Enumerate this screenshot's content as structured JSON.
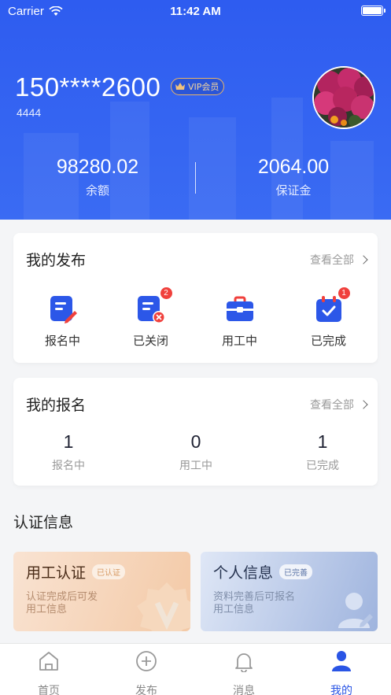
{
  "status_bar": {
    "carrier": "Carrier",
    "time": "11:42 AM"
  },
  "profile": {
    "phone": "150****2600",
    "vip_label": "VIP会员",
    "sub_id": "4444",
    "balance": {
      "value": "98280.02",
      "label": "余额"
    },
    "deposit": {
      "value": "2064.00",
      "label": "保证金"
    }
  },
  "my_publish": {
    "title": "我的发布",
    "view_all": "查看全部",
    "items": [
      {
        "label": "报名中",
        "icon": "edit-doc-icon",
        "badge": ""
      },
      {
        "label": "已关闭",
        "icon": "closed-doc-icon",
        "badge": "2"
      },
      {
        "label": "用工中",
        "icon": "briefcase-icon",
        "badge": ""
      },
      {
        "label": "已完成",
        "icon": "calendar-check-icon",
        "badge": "1"
      }
    ]
  },
  "my_signup": {
    "title": "我的报名",
    "view_all": "查看全部",
    "items": [
      {
        "count": "1",
        "label": "报名中"
      },
      {
        "count": "0",
        "label": "用工中"
      },
      {
        "count": "1",
        "label": "已完成"
      }
    ]
  },
  "certification": {
    "title": "认证信息",
    "cards": [
      {
        "title": "用工认证",
        "tag": "已认证",
        "desc_line1": "认证完成后可发",
        "desc_line2": "用工信息",
        "icon": "v-badge-icon"
      },
      {
        "title": "个人信息",
        "tag": "已完善",
        "desc_line1": "资料完善后可报名",
        "desc_line2": "用工信息",
        "icon": "user-edit-icon"
      }
    ]
  },
  "tabbar": [
    {
      "label": "首页",
      "icon": "home-icon",
      "active": false
    },
    {
      "label": "发布",
      "icon": "plus-circle-icon",
      "active": false
    },
    {
      "label": "消息",
      "icon": "bell-icon",
      "active": false
    },
    {
      "label": "我的",
      "icon": "user-icon",
      "active": true
    }
  ],
  "colors": {
    "primary": "#2e5cf0",
    "badge": "#f0403c",
    "cert_orange": "#f3c8a4",
    "cert_blue": "#9fb4de"
  }
}
